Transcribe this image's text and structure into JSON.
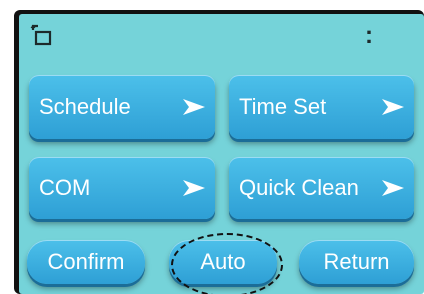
{
  "top_bar": {
    "back_icon": "back-window-icon",
    "menu_icon": "vertical-ellipsis-icon",
    "menu_glyph": ":"
  },
  "tiles": [
    {
      "label": "Schedule",
      "icon": "chevron-right-arrow-icon"
    },
    {
      "label": "Time Set",
      "icon": "chevron-right-arrow-icon"
    },
    {
      "label": "COM",
      "icon": "chevron-right-arrow-icon"
    },
    {
      "label": "Quick Clean",
      "icon": "chevron-right-arrow-icon"
    }
  ],
  "bottom_buttons": [
    {
      "label": "Confirm"
    },
    {
      "label": "Auto",
      "highlighted": true
    },
    {
      "label": "Return"
    }
  ],
  "colors": {
    "screen_bg": "#75d3d9",
    "button": "#3bb0e0",
    "text": "#ffffff"
  }
}
